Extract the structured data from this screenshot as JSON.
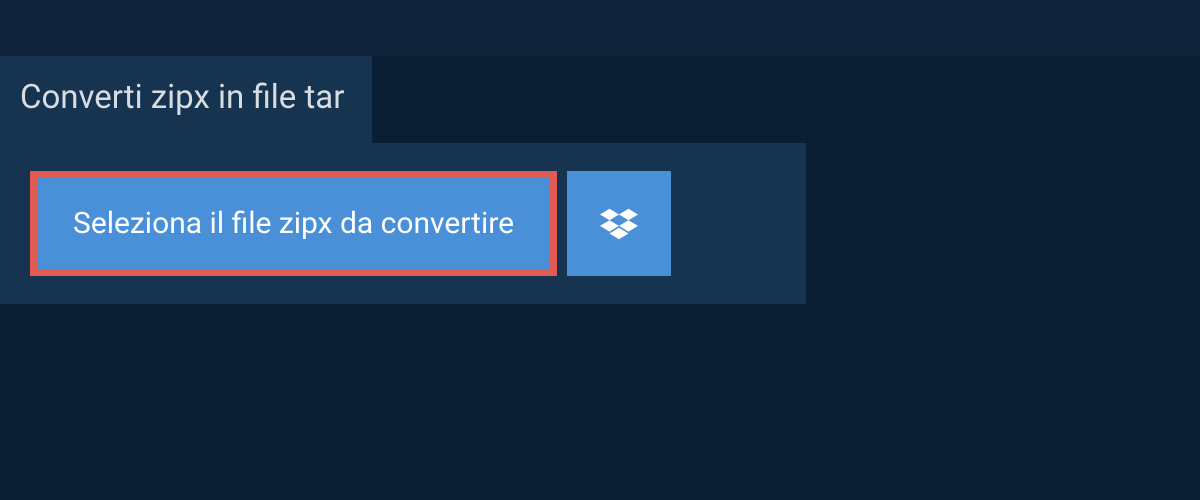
{
  "title": "Converti zipx in file tar",
  "select_button_label": "Seleziona il file zipx da convertire",
  "colors": {
    "bg_dark": "#0a1e33",
    "bg_topbar": "#10253b",
    "bg_panel": "#163450",
    "button_blue": "#4a90d9",
    "highlight_red": "#e15a54",
    "text_light": "#d8dde2"
  }
}
